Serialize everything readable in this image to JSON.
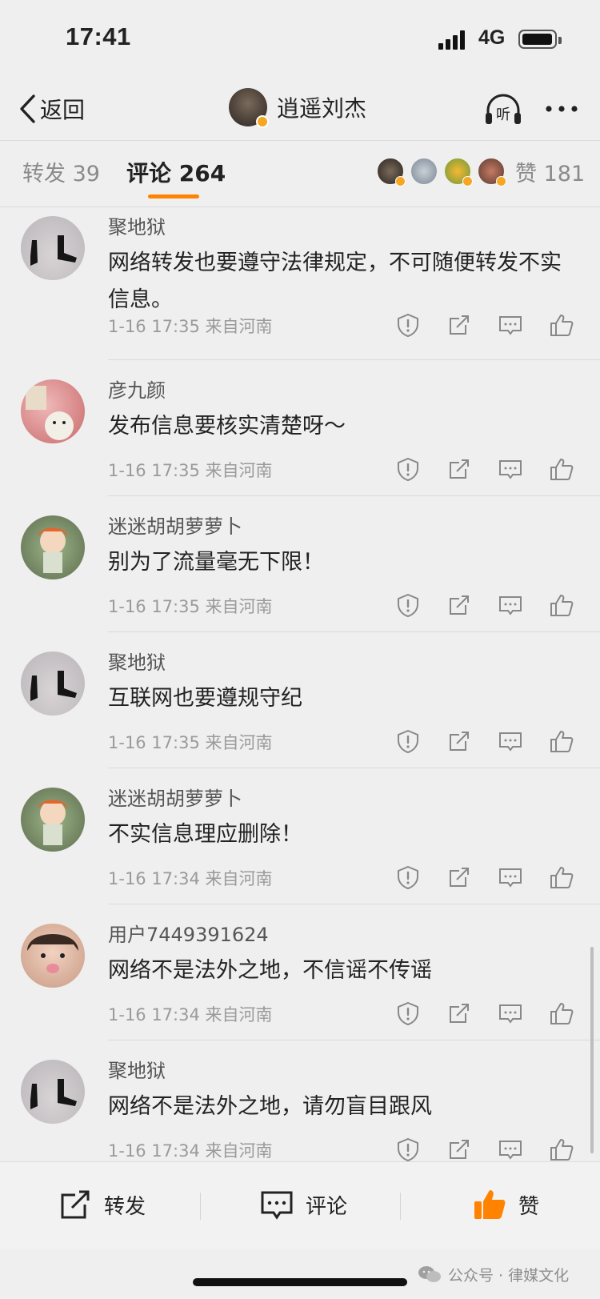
{
  "status_bar": {
    "time": "17:41",
    "network": "4G"
  },
  "nav": {
    "back_label": "返回",
    "title": "逍遥刘杰",
    "listen_label": "听"
  },
  "tabs": {
    "repost_label": "转发 39",
    "comment_label": "评论 264",
    "likes_label": "赞 181",
    "accent_color": "#ff8200"
  },
  "comments": [
    {
      "avatar": "boots",
      "name": "聚地狱",
      "text": "网络转发也要遵守法律规定，不可随便转发不实信息。",
      "meta": "1-16 17:35  来自河南"
    },
    {
      "avatar": "room",
      "name": "彦九颜",
      "text": "发布信息要核实清楚呀～",
      "meta": "1-16 17:35  来自河南"
    },
    {
      "avatar": "girl",
      "name": "迷迷胡胡萝萝卜",
      "text": "别为了流量毫无下限！",
      "meta": "1-16 17:35  来自河南"
    },
    {
      "avatar": "boots",
      "name": "聚地狱",
      "text": "互联网也要遵规守纪",
      "meta": "1-16 17:35  来自河南"
    },
    {
      "avatar": "girl",
      "name": "迷迷胡胡萝萝卜",
      "text": "不实信息理应删除！",
      "meta": "1-16 17:34  来自河南"
    },
    {
      "avatar": "kid",
      "name": "用户7449391624",
      "text": "网络不是法外之地，不信谣不传谣",
      "meta": "1-16 17:34  来自河南"
    },
    {
      "avatar": "boots",
      "name": "聚地狱",
      "text": "网络不是法外之地，请勿盲目跟风",
      "meta": "1-16 17:34  来自河南"
    }
  ],
  "bottom_bar": {
    "repost_label": "转发",
    "comment_label": "评论",
    "like_label": "赞",
    "like_color": "#ff8200"
  },
  "watermark": {
    "text": "公众号 · 律媒文化"
  }
}
